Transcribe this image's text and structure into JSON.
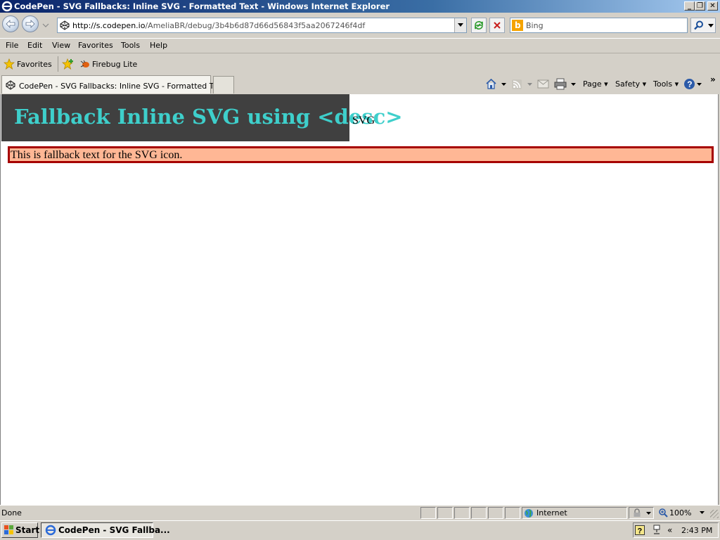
{
  "window": {
    "title": "CodePen - SVG Fallbacks: Inline SVG - Formatted Text - Windows Internet Explorer",
    "minimize_glyph": "_",
    "restore_glyph": "❐",
    "close_glyph": "✕"
  },
  "address_bar": {
    "url_prefix": "http://s.codepen.io",
    "url_path": "/AmeliaBR/debug/3b4b6d87d66d56843f5aa2067246f4df"
  },
  "search": {
    "placeholder": "Bing"
  },
  "menu": [
    "File",
    "Edit",
    "View",
    "Favorites",
    "Tools",
    "Help"
  ],
  "favorites_bar": {
    "favorites_label": "Favorites",
    "item": "Firebug Lite"
  },
  "tab": {
    "title": "CodePen - SVG Fallbacks: Inline SVG - Formatted Text"
  },
  "command_bar": {
    "page": "Page",
    "safety": "Safety",
    "tools": "Tools"
  },
  "page": {
    "heading": "Fallback Inline SVG using <desc>",
    "svg_text": "SVG",
    "fallback_text": "This is fallback text for the SVG icon."
  },
  "status": {
    "text": "Done",
    "zone": "Internet",
    "zoom": "100%"
  },
  "taskbar": {
    "start": "Start",
    "item": "CodePen - SVG Fallba...",
    "chevron": "«",
    "clock": "2:43 PM"
  },
  "colors": {
    "heading_bg": "#404040",
    "heading_text": "#3ecfcb",
    "fallback_bg": "#ffb795",
    "fallback_border": "#a60000"
  }
}
